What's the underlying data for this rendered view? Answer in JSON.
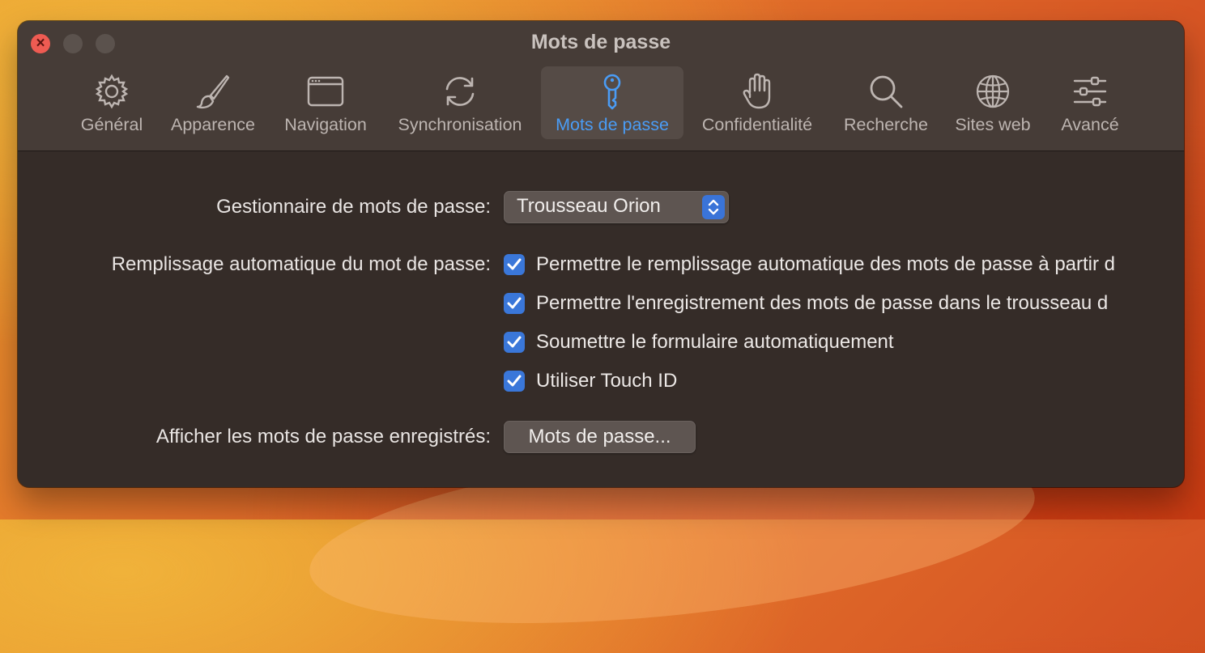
{
  "window": {
    "title": "Mots de passe"
  },
  "toolbar": {
    "tabs": [
      {
        "label": "Général",
        "icon": "gear-icon"
      },
      {
        "label": "Apparence",
        "icon": "paintbrush-icon"
      },
      {
        "label": "Navigation",
        "icon": "browser-window-icon"
      },
      {
        "label": "Synchronisation",
        "icon": "sync-icon"
      },
      {
        "label": "Mots de passe",
        "icon": "key-icon",
        "active": true
      },
      {
        "label": "Confidentialité",
        "icon": "hand-icon"
      },
      {
        "label": "Recherche",
        "icon": "magnifier-icon"
      },
      {
        "label": "Sites web",
        "icon": "globe-icon"
      },
      {
        "label": "Avancé",
        "icon": "sliders-icon"
      }
    ]
  },
  "settings": {
    "password_manager": {
      "label": "Gestionnaire de mots de passe:",
      "value": "Trousseau Orion"
    },
    "autofill": {
      "label": "Remplissage automatique du mot de passe:",
      "options": [
        {
          "label": "Permettre le remplissage automatique des mots de passe à partir d",
          "checked": true
        },
        {
          "label": "Permettre l'enregistrement des mots de passe dans le trousseau d",
          "checked": true
        },
        {
          "label": "Soumettre le formulaire automatiquement",
          "checked": true
        },
        {
          "label": "Utiliser Touch ID",
          "checked": true
        }
      ]
    },
    "saved_passwords": {
      "label": "Afficher les mots de passe enregistrés:",
      "button": "Mots de passe..."
    }
  },
  "colors": {
    "accent": "#3a77d9",
    "active_tab_text": "#4a9cf5",
    "window_bg": "#352c28",
    "toolbar_bg": "#463c37",
    "close_button": "#ee5b52"
  }
}
